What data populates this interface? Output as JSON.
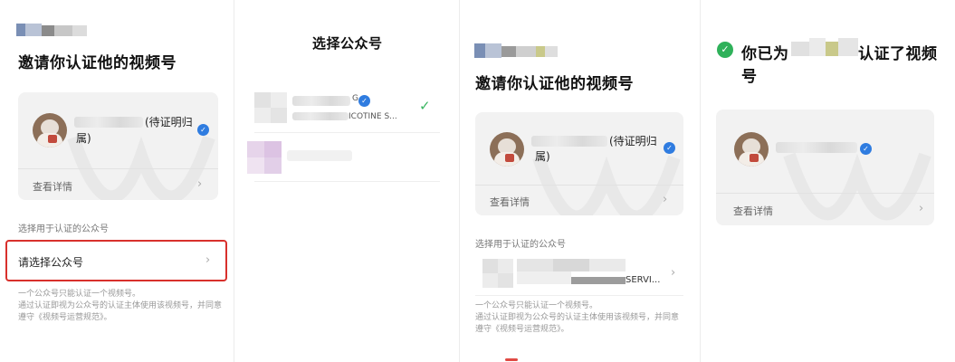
{
  "panel1": {
    "title": "邀请你认证他的视频号",
    "status": "(待证明归",
    "status_cont": "属)",
    "details": "查看详情",
    "section_label": "选择用于认证的公众号",
    "select_prompt": "请选择公众号",
    "hint_line1": "一个公众号只能认证一个视频号。",
    "hint_line2": "通过认证即视为公众号的认证主体使用该视频号，并同意",
    "hint_line3": "遵守《视频号运营规范》。"
  },
  "panel2": {
    "title": "选择公众号",
    "item1_partial": "G",
    "item1_sub": "ICOTINE S...",
    "check": "✓"
  },
  "panel3": {
    "title": "邀请你认证他的视频号",
    "status": "(待证明归",
    "status_cont": "属)",
    "details": "查看详情",
    "section_label": "选择用于认证的公众号",
    "selected_account": "SERVI...",
    "hint_line1": "一个公众号只能认证一个视频号。",
    "hint_line2": "通过认证即视为公众号的认证主体使用该视频号，并同意",
    "hint_line3": "遵守《视频号运营规范》。"
  },
  "panel4": {
    "title_prefix": "你已为",
    "title_suffix": "认证了视频",
    "title_line2": "号",
    "details": "查看详情"
  },
  "icons": {
    "verified": "verified-badge-icon",
    "chevron": "chevron-right-icon",
    "check": "check-icon",
    "success": "check-circle-icon"
  },
  "colors": {
    "highlight": "#d8302c",
    "verified": "#2f7ce0",
    "success": "#2fb15a",
    "card_bg": "#f2f2f2"
  }
}
